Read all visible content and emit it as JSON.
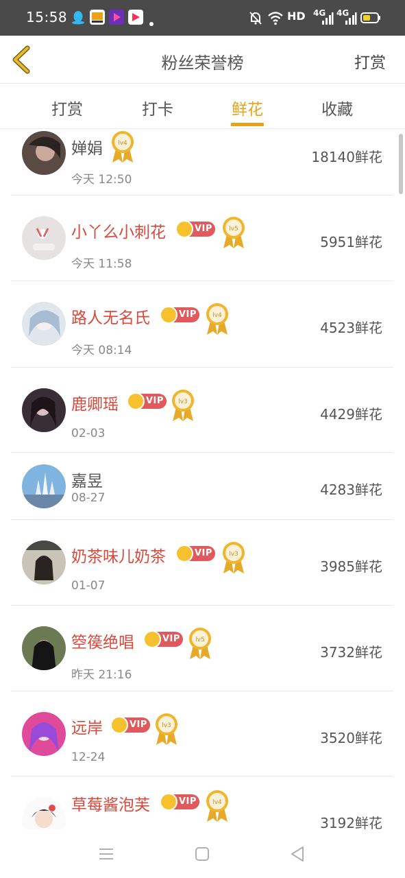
{
  "status_bar": {
    "time": "15:58",
    "network_label": "HD",
    "signal_1": "4G",
    "signal_2": "4G"
  },
  "header": {
    "title": "粉丝荣誉榜",
    "action": "打赏",
    "back_icon": "chevron-left-icon"
  },
  "tabs": [
    {
      "label": "打赏",
      "active": false
    },
    {
      "label": "打卡",
      "active": false
    },
    {
      "label": "鲜花",
      "active": true
    },
    {
      "label": "收藏",
      "active": false
    }
  ],
  "fans": [
    {
      "name": "婵娟",
      "time": "今天 12:50",
      "vip": false,
      "level": "lv4",
      "score": "18140鲜花"
    },
    {
      "name": "小丫么小刺花",
      "time": "今天 11:58",
      "vip": true,
      "vip_label": "VIP",
      "level": "lv5",
      "score": "5951鲜花"
    },
    {
      "name": "路人无名氏",
      "time": "今天 08:14",
      "vip": true,
      "vip_label": "VIP",
      "level": "lv4",
      "score": "4523鲜花"
    },
    {
      "name": "鹿卿瑶",
      "time": "02-03",
      "vip": true,
      "vip_label": "VIP",
      "level": "lv3",
      "score": "4429鲜花"
    },
    {
      "name": "嘉昱",
      "time": "08-27",
      "vip": false,
      "level": "",
      "score": "4283鲜花"
    },
    {
      "name": "奶茶味儿奶茶",
      "time": "01-07",
      "vip": true,
      "vip_label": "VIP",
      "level": "lv3",
      "score": "3985鲜花"
    },
    {
      "name": "箜篌绝唱",
      "time": "昨天 21:16",
      "vip": true,
      "vip_label": "VIP",
      "level": "lv5",
      "score": "3732鲜花"
    },
    {
      "name": "远岸",
      "time": "12-24",
      "vip": true,
      "vip_label": "VIP",
      "level": "lv3",
      "score": "3520鲜花"
    },
    {
      "name": "草莓酱泡芙",
      "time": "",
      "vip": true,
      "vip_label": "VIP",
      "level": "lv4",
      "score": "3192鲜花"
    }
  ],
  "colors": {
    "accent": "#e9a21a",
    "vip_name": "#d9483b",
    "vip_badge": "#e0595c",
    "medal_gold": "#e6a92a"
  },
  "system_nav": [
    "menu-icon",
    "home-square-icon",
    "back-triangle-icon"
  ]
}
